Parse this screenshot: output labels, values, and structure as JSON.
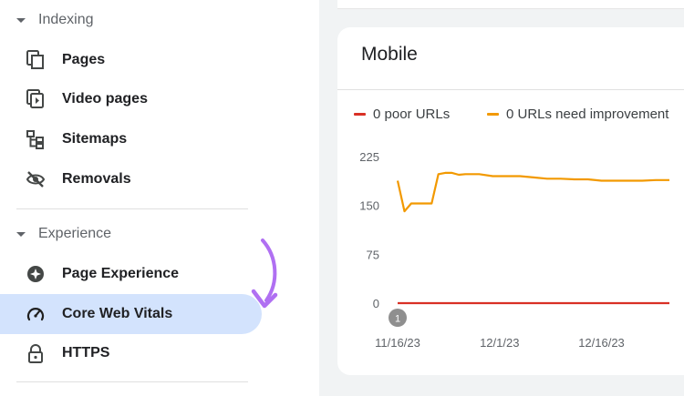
{
  "sidebar": {
    "sections": [
      {
        "title": "Indexing",
        "items": [
          {
            "label": "Pages",
            "icon": "pages-icon"
          },
          {
            "label": "Video pages",
            "icon": "video-pages-icon"
          },
          {
            "label": "Sitemaps",
            "icon": "sitemaps-icon"
          },
          {
            "label": "Removals",
            "icon": "removals-icon"
          }
        ]
      },
      {
        "title": "Experience",
        "items": [
          {
            "label": "Page Experience",
            "icon": "page-experience-icon"
          },
          {
            "label": "Core Web Vitals",
            "icon": "core-web-vitals-icon",
            "active": true
          },
          {
            "label": "HTTPS",
            "icon": "lock-icon"
          }
        ]
      }
    ]
  },
  "card": {
    "title": "Mobile",
    "legend": [
      {
        "label": "0 poor URLs",
        "color": "#d93025"
      },
      {
        "label": "0 URLs need improvement",
        "color": "#f29900"
      }
    ]
  },
  "chart_data": {
    "type": "line",
    "y_ticks": [
      "225",
      "150",
      "75",
      "0"
    ],
    "ylim": [
      0,
      225
    ],
    "x_ticks": [
      "11/16/23",
      "12/1/23",
      "12/16/23"
    ],
    "annotation_marker": "1",
    "series": [
      {
        "name": "0 URLs need improvement",
        "color": "#f29900",
        "x": [
          "11/16/23",
          "11/17/23",
          "11/18/23",
          "11/19/23",
          "11/20/23",
          "11/21/23",
          "11/22/23",
          "11/23/23",
          "11/24/23",
          "11/25/23",
          "11/26/23",
          "11/28/23",
          "11/30/23",
          "12/2/23",
          "12/4/23",
          "12/6/23",
          "12/8/23",
          "12/10/23",
          "12/12/23",
          "12/14/23",
          "12/16/23",
          "12/18/23",
          "12/20/23",
          "12/22/23",
          "12/24/23",
          "12/26/23"
        ],
        "values": [
          188,
          141,
          153,
          153,
          153,
          153,
          198,
          200,
          200,
          197,
          198,
          198,
          195,
          195,
          195,
          193,
          191,
          191,
          190,
          190,
          188,
          188,
          188,
          188,
          189,
          189
        ]
      },
      {
        "name": "0 poor URLs",
        "color": "#d93025",
        "x": [
          "11/16/23",
          "12/26/23"
        ],
        "values": [
          0,
          0
        ]
      }
    ]
  }
}
